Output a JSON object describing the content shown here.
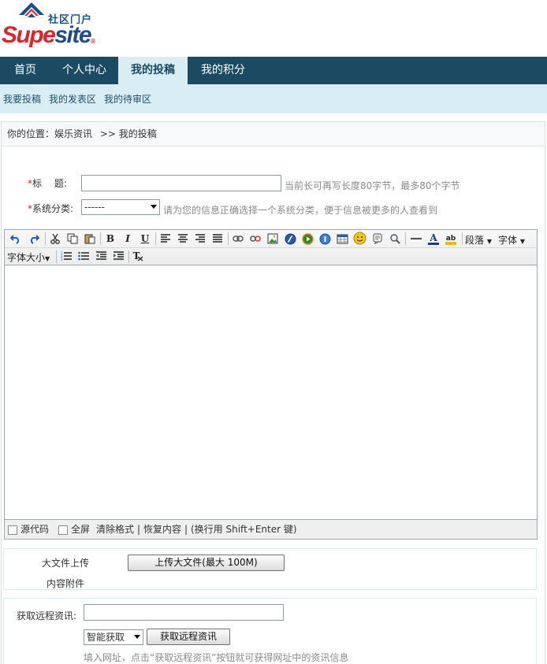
{
  "logo": {
    "cn": "社区门户",
    "en_supe": "Supe",
    "en_site": "site",
    "mark": "®"
  },
  "nav": {
    "items": [
      "首页",
      "个人中心",
      "我的投稿",
      "我的积分"
    ],
    "active": 2
  },
  "subnav": {
    "items": [
      "我要投稿",
      "我的发表区",
      "我的待审区"
    ]
  },
  "breadcrumb": {
    "prefix": "你的位置：",
    "section": "娱乐资讯",
    "sep": ">>",
    "current": "我的投稿"
  },
  "form": {
    "required_mark": "*",
    "title_label": "标　 题:",
    "title_value": "",
    "title_hint": "当前长可再写长度80字节，最多80个字节",
    "category_label": "系统分类:",
    "category_value": "------",
    "category_hint": "请为您的信息正确选择一个系统分类，便于信息被更多的人查看到"
  },
  "editor": {
    "toolbar_icons": [
      "undo-icon",
      "redo-icon",
      "cut-icon",
      "copy-icon",
      "paste-icon",
      "bold-icon",
      "italic-icon",
      "underline-icon",
      "align-left-icon",
      "align-center-icon",
      "align-right-icon",
      "justify-icon",
      "link-icon",
      "unlink-icon",
      "image-icon",
      "flash-icon",
      "media-icon",
      "info-icon",
      "table-icon",
      "emoticon-icon",
      "quote-icon",
      "find-icon",
      "horizontal-rule-icon",
      "font-color-icon",
      "highlight-icon"
    ],
    "bold": "B",
    "italic": "I",
    "underline": "U",
    "paragraph_menu": "段落",
    "font_menu": "字体",
    "font_size_menu": "字体大小",
    "status": {
      "source_label": "源代码",
      "fullscreen_label": "全屏",
      "clear_format": "清除格式",
      "restore": "恢复内容",
      "newline_hint": "(换行用 Shift+Enter 键)",
      "divider": "|"
    }
  },
  "upload": {
    "label_line1": "大文件上传",
    "label_line2": "内容附件",
    "button": "上传大文件(最大  100M)"
  },
  "remote": {
    "label": "获取远程资讯:",
    "url_value": "",
    "mode_value": "智能获取",
    "button": "获取远程资讯",
    "hint": "填入网址，点击“获取远程资讯”按钮就可获得网址中的资讯信息"
  }
}
